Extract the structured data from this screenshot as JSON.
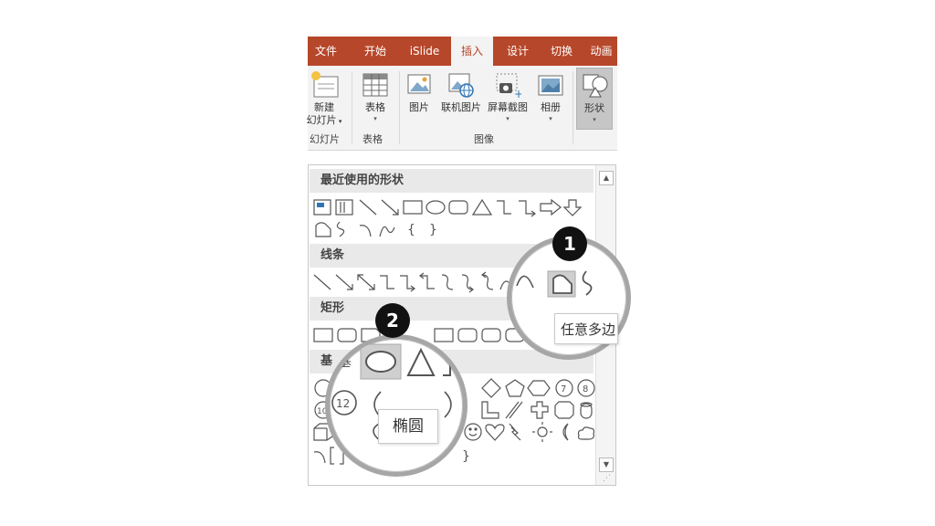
{
  "ribbon": {
    "tabs": [
      {
        "label": "文件"
      },
      {
        "label": "开始"
      },
      {
        "label": "iSlide"
      },
      {
        "label": "插入",
        "active": true
      },
      {
        "label": "设计"
      },
      {
        "label": "切换"
      },
      {
        "label": "动画"
      }
    ],
    "buttons": {
      "new_slide_line1": "新建",
      "new_slide_line2": "幻灯片",
      "table": "表格",
      "picture": "图片",
      "online_picture": "联机图片",
      "screenshot": "屏幕截图",
      "album": "相册",
      "shapes": "形状"
    },
    "groups": {
      "slides": "幻灯片",
      "tables": "表格",
      "images": "图像"
    }
  },
  "gallery": {
    "sections": {
      "recent": "最近使用的形状",
      "lines": "线条",
      "rect": "矩形",
      "basic": "基"
    }
  },
  "callouts": {
    "one": {
      "badge": "1",
      "tooltip": "任意多边"
    },
    "two": {
      "badge": "2",
      "tooltip": "椭圆"
    }
  },
  "colors": {
    "accent": "#b7472a",
    "ribbon_bg": "#f3f3f3",
    "shape_stroke": "#555555",
    "magnifier_ring": "#a6a6a6"
  }
}
